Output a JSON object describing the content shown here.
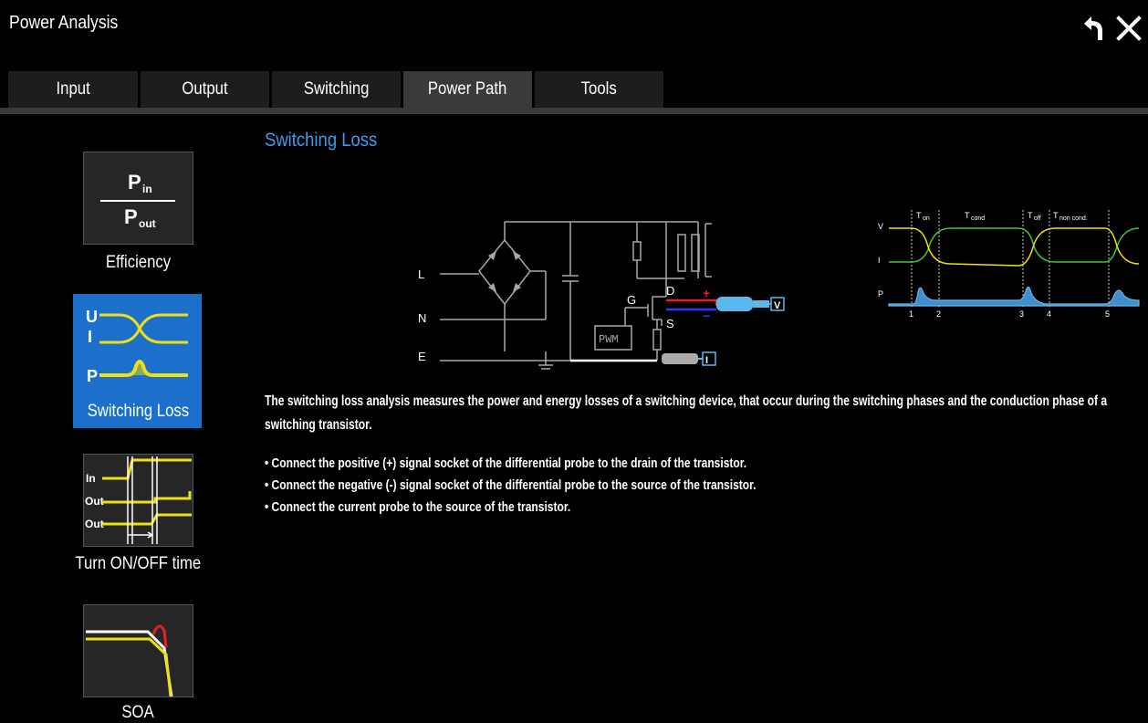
{
  "window": {
    "title": "Power Analysis"
  },
  "toolbar": {
    "back_icon": "undo-arrow-icon",
    "close_icon": "close-icon"
  },
  "tabs": [
    {
      "label": "Input",
      "active": false
    },
    {
      "label": "Output",
      "active": false
    },
    {
      "label": "Switching",
      "active": false
    },
    {
      "label": "Power Path",
      "active": true
    },
    {
      "label": "Tools",
      "active": false
    }
  ],
  "sidebar": {
    "items": [
      {
        "label": "Efficiency",
        "icon": "efficiency-ratio-icon",
        "formula_top": "P",
        "formula_top_sub": "in",
        "formula_bottom": "P",
        "formula_bottom_sub": "out",
        "selected": false
      },
      {
        "label": "Switching Loss",
        "icon": "switching-loss-waveform-icon",
        "letters": [
          "U",
          "I",
          "P"
        ],
        "selected": true
      },
      {
        "label": "Turn ON/OFF time",
        "icon": "turn-on-off-time-icon",
        "letters": [
          "In",
          "Out",
          "Out"
        ],
        "selected": false
      },
      {
        "label": "SOA",
        "icon": "soa-curve-icon",
        "selected": false
      }
    ]
  },
  "main": {
    "section_title": "Switching Loss",
    "circuit": {
      "labels": {
        "L": "L",
        "N": "N",
        "E": "E",
        "G": "G",
        "D": "D",
        "S": "S",
        "pwm": "PWM",
        "plus": "+",
        "minus": "−",
        "v_probe": "V",
        "i_probe": "I"
      }
    },
    "waveform": {
      "labels": {
        "t_on": "T",
        "t_on_sub": "on",
        "t_cond": "T",
        "t_cond_sub": "cond",
        "t_off": "T",
        "t_off_sub": "off",
        "t_noncond": "T",
        "t_noncond_sub": "non cond.",
        "v": "V",
        "i": "I",
        "p": "P"
      },
      "markers": [
        "1",
        "2",
        "3",
        "4",
        "5"
      ]
    },
    "description": "The switching loss analysis measures the power and energy losses of a switching device, that occur during the switching phases and the conduction phase of a switching transistor.",
    "instructions": [
      "• Connect the positive (+) signal socket of the differential probe to the drain of the transistor.",
      "• Connect the negative (-) signal socket of the differential probe to the source of the transistor.",
      "• Connect the current probe to the source of the transistor."
    ]
  },
  "colors": {
    "accent": "#3d9cf0",
    "selected": "#1d6fcc",
    "tab_active": "#3a3a3a",
    "tab": "#1d1d1d",
    "trace_yellow": "#f0e010",
    "trace_green": "#3ec43e",
    "trace_blue": "#6bb6e8"
  }
}
